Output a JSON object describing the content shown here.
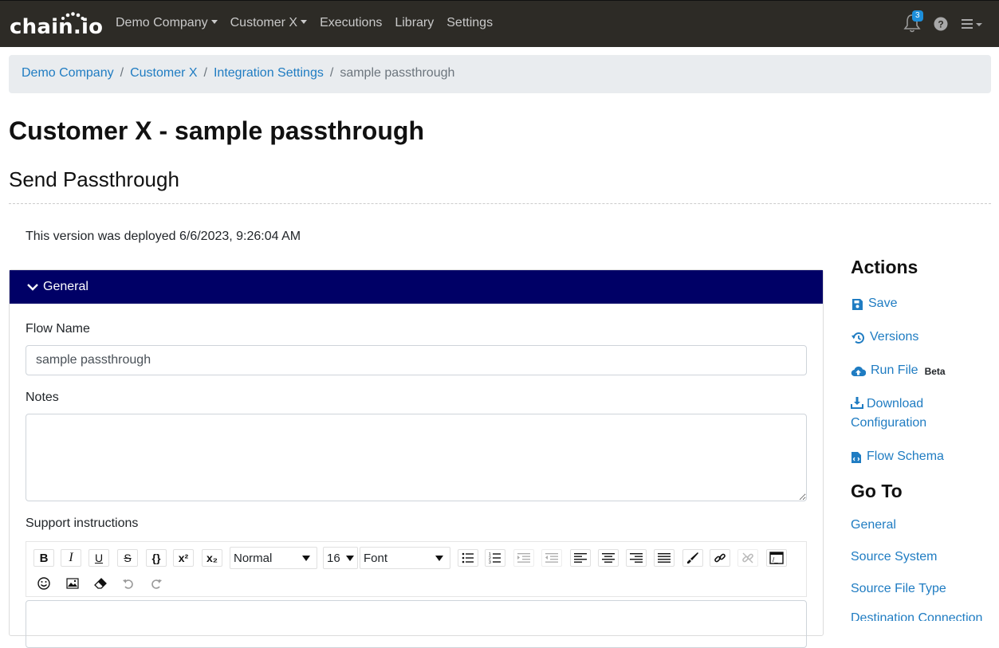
{
  "app": {
    "logo": "chain.io"
  },
  "nav": {
    "items": [
      "Demo Company",
      "Customer X",
      "Executions",
      "Library",
      "Settings"
    ],
    "notification_count": "3"
  },
  "breadcrumb": {
    "items": [
      "Demo Company",
      "Customer X",
      "Integration Settings"
    ],
    "current": "sample passthrough"
  },
  "page": {
    "title": "Customer X - sample passthrough",
    "subtitle": "Send Passthrough",
    "deployed_text": "This version was deployed 6/6/2023, 9:26:04 AM"
  },
  "panel": {
    "header": "General",
    "flow_name_label": "Flow Name",
    "flow_name_value": "sample passthrough",
    "notes_label": "Notes",
    "notes_value": "",
    "support_label": "Support instructions",
    "toolbar": {
      "style_select": "Normal",
      "size_select": "16",
      "font_select": "Font"
    }
  },
  "actions": {
    "title": "Actions",
    "save": "Save",
    "versions": "Versions",
    "run_file": "Run File",
    "beta": "Beta",
    "download_1": "Download",
    "download_2": "Configuration",
    "flow_schema": "Flow Schema"
  },
  "goto": {
    "title": "Go To",
    "items": [
      "General",
      "Source System",
      "Source File Type",
      "Destination Connection"
    ]
  },
  "colors": {
    "topbar": "#2d2b26",
    "panel_header": "#000066",
    "link": "#1f7cc2",
    "badge": "#1d8fdb"
  }
}
